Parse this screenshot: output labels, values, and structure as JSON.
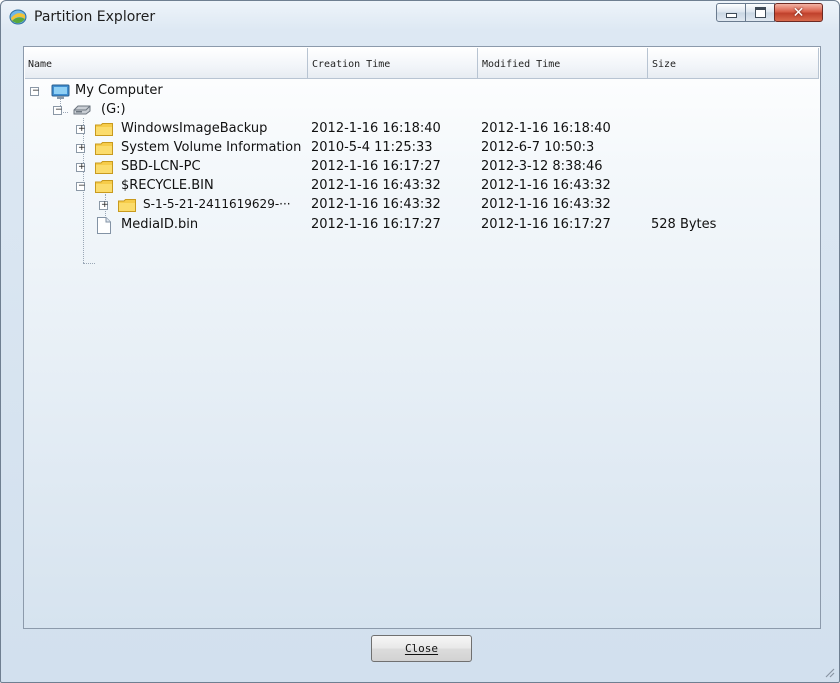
{
  "window": {
    "title": "Partition Explorer"
  },
  "columns": [
    "Name",
    "Creation Time",
    "Modified Time",
    "Size"
  ],
  "tree": {
    "root": {
      "label": "My Computer",
      "expanded": true,
      "icon": "computer-icon"
    },
    "drive": {
      "label": "(G:)",
      "expanded": true,
      "icon": "drive-icon"
    },
    "items": [
      {
        "name": "WindowsImageBackup",
        "created": "2012-1-16 16:18:40",
        "modified": "2012-1-16 16:18:40",
        "size": "",
        "type": "folder",
        "expander": "+"
      },
      {
        "name": "System Volume Information",
        "created": "2010-5-4 11:25:33",
        "modified": "2012-6-7 10:50:3",
        "size": "",
        "type": "folder",
        "expander": "+"
      },
      {
        "name": "SBD-LCN-PC",
        "created": "2012-1-16 16:17:27",
        "modified": "2012-3-12 8:38:46",
        "size": "",
        "type": "folder",
        "expander": "+"
      },
      {
        "name": "$RECYCLE.BIN",
        "created": "2012-1-16 16:43:32",
        "modified": "2012-1-16 16:43:32",
        "size": "",
        "type": "folder",
        "expander": "−"
      },
      {
        "name": "S-1-5-21-2411619629-···",
        "created": "2012-1-16 16:43:32",
        "modified": "2012-1-16 16:43:32",
        "size": "",
        "type": "folder",
        "expander": "+"
      },
      {
        "name": "MediaID.bin",
        "created": "2012-1-16 16:17:27",
        "modified": "2012-1-16 16:17:27",
        "size": "528 Bytes",
        "type": "file",
        "expander": ""
      }
    ]
  },
  "buttons": {
    "close": "Close"
  }
}
